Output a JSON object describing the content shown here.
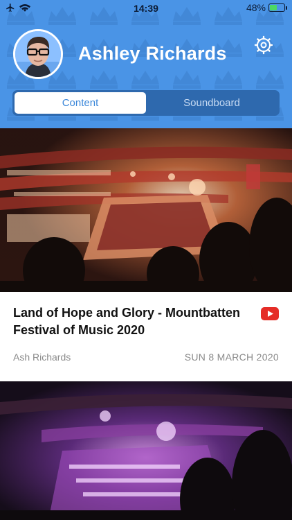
{
  "status_bar": {
    "time": "14:39",
    "battery_text": "48%",
    "battery_level": 0.48,
    "airplane_icon": "airplane-icon",
    "wifi_icon": "wifi-icon",
    "charging_icon": "bolt-icon"
  },
  "header": {
    "name": "Ashley Richards",
    "avatar_icon": "avatar-portrait",
    "settings_icon": "gear-icon",
    "background_color": "#4a94e6"
  },
  "segmented_control": {
    "tabs": [
      {
        "label": "Content",
        "selected": true
      },
      {
        "label": "Soundboard",
        "selected": false
      }
    ]
  },
  "feed": {
    "items": [
      {
        "title": "Land of Hope and Glory - Mountbatten Festival of Music 2020",
        "author": "Ash Richards",
        "date": "SUN 8 MARCH 2020",
        "source_icon": "youtube-icon",
        "source_color": "#e52d27"
      },
      {
        "title": "",
        "author": "",
        "date": "",
        "source_icon": "youtube-icon"
      }
    ]
  }
}
